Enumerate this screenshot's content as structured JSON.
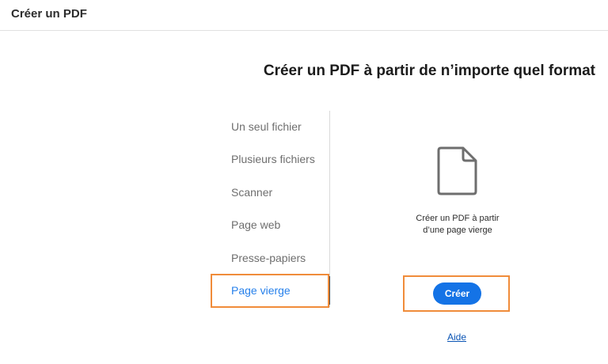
{
  "header": {
    "title": "Créer un PDF"
  },
  "main": {
    "headline": "Créer un PDF à partir de n’importe quel format"
  },
  "sidebar": {
    "items": [
      {
        "label": "Un seul fichier",
        "active": false
      },
      {
        "label": "Plusieurs fichiers",
        "active": false
      },
      {
        "label": "Scanner",
        "active": false
      },
      {
        "label": "Page web",
        "active": false
      },
      {
        "label": "Presse-papiers",
        "active": false
      },
      {
        "label": "Page vierge",
        "active": true
      }
    ]
  },
  "panel": {
    "icon": "blank-document-icon",
    "description_line1": "Créer un PDF à partir",
    "description_line2": "d’une page vierge",
    "create_label": "Créer",
    "help_label": "Aide"
  },
  "colors": {
    "accent": "#1473e6",
    "active_item": "#2680eb",
    "highlight": "#f08c3a",
    "link": "#0b55b5"
  }
}
